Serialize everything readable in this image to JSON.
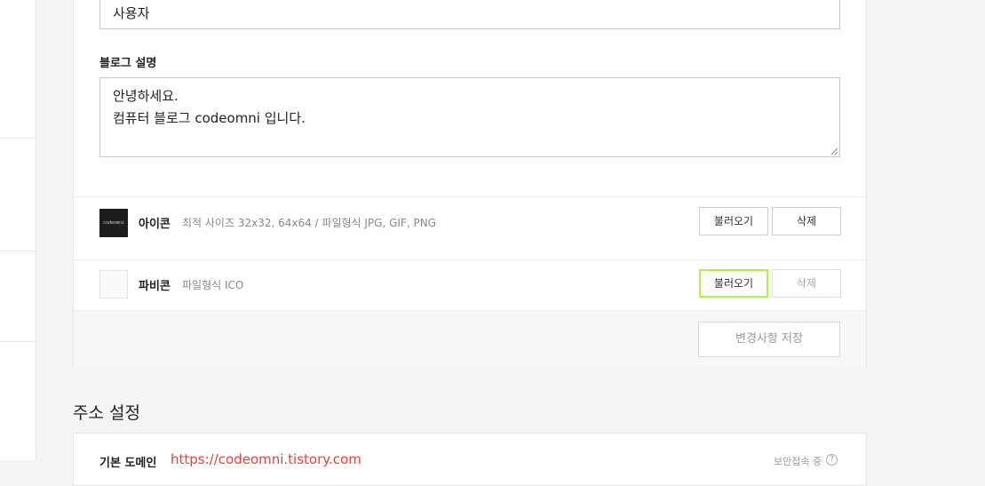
{
  "blog": {
    "name_value": "사용자",
    "desc_label": "블로그 설명",
    "desc_lines": [
      "안녕하세요.",
      "컴퓨터 블로그 codeomni 입니다."
    ]
  },
  "icon_row": {
    "title": "아이콘",
    "desc": "최적 사이즈 32x32, 64x64 / 파일형식 JPG, GIF, PNG",
    "thumb_text": "codeomni",
    "load_label": "불러오기",
    "delete_label": "삭제"
  },
  "favicon_row": {
    "title": "파비콘",
    "desc": "파일형식 ICO",
    "load_label": "불러오기",
    "delete_label": "삭제"
  },
  "footer": {
    "save_label": "변경사항 저장"
  },
  "address_section": {
    "title": "주소 설정",
    "domain_label": "기본 도메인",
    "domain_url": "https://codeomni.tistory.com",
    "status": "보안접속 중",
    "help_icon": "?"
  },
  "colors": {
    "focus": "#b4f04a",
    "url": "#e5433c"
  }
}
